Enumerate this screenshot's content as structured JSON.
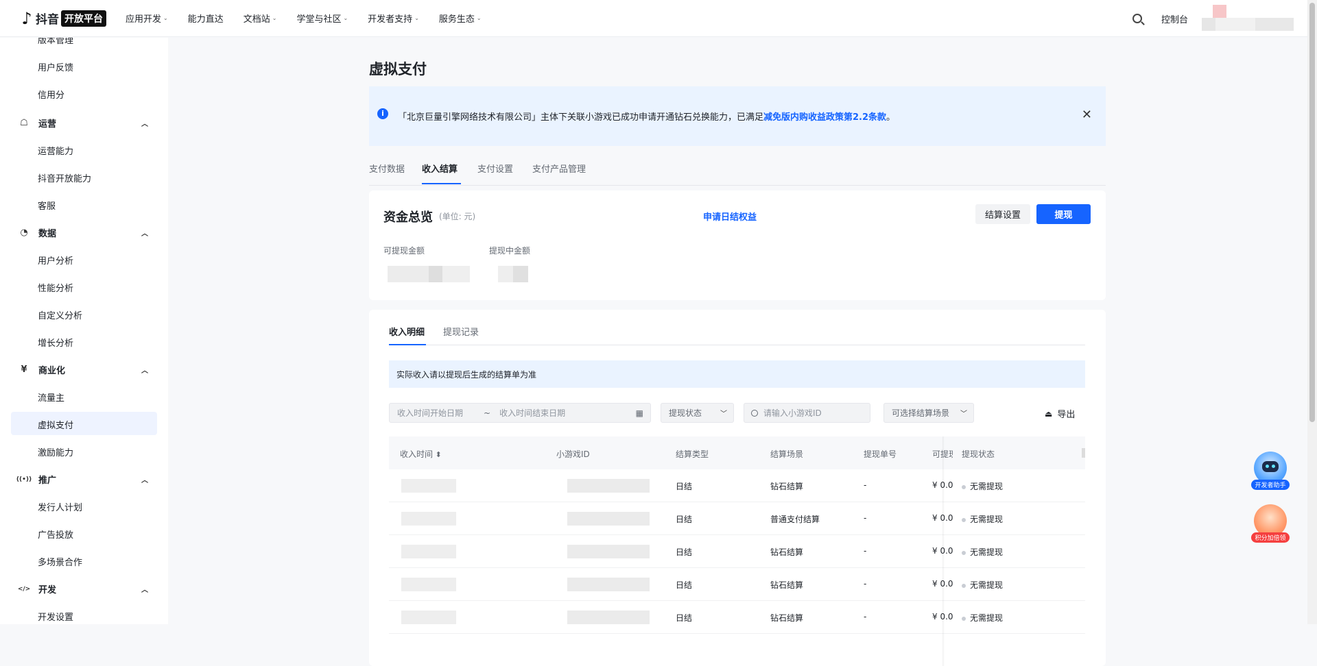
{
  "header": {
    "logo_mark": "♪",
    "logo_text": "抖音",
    "logo_badge": "开放平台",
    "nav": [
      "应用开发",
      "能力直达",
      "文档站",
      "学堂与社区",
      "开发者支持",
      "服务生态"
    ],
    "nav_has_caret": [
      true,
      false,
      true,
      true,
      true,
      true
    ],
    "console": "控制台"
  },
  "sidebar": {
    "items_top": [
      "版本管理",
      "用户反馈",
      "信用分"
    ],
    "groups": [
      {
        "label": "运营",
        "icon": "☖",
        "items": [
          "运营能力",
          "抖音开放能力",
          "客服"
        ]
      },
      {
        "label": "数据",
        "icon": "◔",
        "items": [
          "用户分析",
          "性能分析",
          "自定义分析",
          "增长分析"
        ]
      },
      {
        "label": "商业化",
        "icon": "¥",
        "items": [
          "流量主",
          "虚拟支付",
          "激励能力"
        ]
      },
      {
        "label": "推广",
        "icon": "((•))",
        "items": [
          "发行人计划",
          "广告投放",
          "多场景合作"
        ]
      },
      {
        "label": "开发",
        "icon": "</>",
        "items": [
          "开发设置"
        ]
      }
    ],
    "active": "虚拟支付"
  },
  "page": {
    "title": "虚拟支付",
    "alert_text": "「北京巨量引擎网络技术有限公司」主体下关联小游戏已成功申请开通钻石兑换能力，已满足",
    "alert_link": "减免版内购收益政策第2.2条款",
    "alert_suffix": "。",
    "tabs": [
      "支付数据",
      "收入结算",
      "支付设置",
      "支付产品管理"
    ],
    "active_tab": "收入结算"
  },
  "overview": {
    "title": "资金总览",
    "unit": "(单位: 元)",
    "daily_link": "申请日结权益",
    "settle_btn": "结算设置",
    "withdraw_btn": "提现",
    "label_available": "可提现金额",
    "label_pending": "提现中金额"
  },
  "detail": {
    "tabs": [
      "收入明细",
      "提现记录"
    ],
    "notice": "实际收入请以提现后生成的结算单为准",
    "start_placeholder": "收入时间开始日期",
    "date_sep": "~",
    "end_placeholder": "收入时间结束日期",
    "status_filter": "提现状态",
    "search_placeholder": "请输入小游戏ID",
    "scene_filter": "可选择结算场景",
    "export": "导出",
    "columns": [
      "收入时间",
      "小游戏ID",
      "结算类型",
      "结算场景",
      "提现单号",
      "可提现",
      "提现状态"
    ],
    "rows": [
      {
        "type": "日结",
        "scene": "钻石结算",
        "order": "-",
        "amount": "¥ 0.0",
        "status": "无需提现"
      },
      {
        "type": "日结",
        "scene": "普通支付结算",
        "order": "-",
        "amount": "¥ 0.0",
        "status": "无需提现"
      },
      {
        "type": "日结",
        "scene": "钻石结算",
        "order": "-",
        "amount": "¥ 0.0",
        "status": "无需提现"
      },
      {
        "type": "日结",
        "scene": "钻石结算",
        "order": "-",
        "amount": "¥ 0.0",
        "status": "无需提现"
      },
      {
        "type": "日结",
        "scene": "钻石结算",
        "order": "-",
        "amount": "¥ 0.0",
        "status": "无需提现"
      }
    ]
  },
  "floating": {
    "assistant": "开发者助手",
    "points": "积分加倍领"
  }
}
